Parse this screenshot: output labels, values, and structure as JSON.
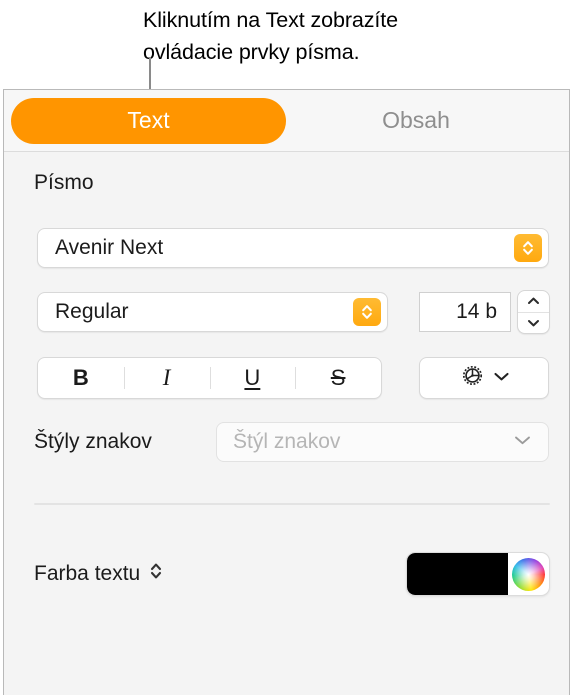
{
  "callout": {
    "line1": "Kliknutím na Text zobrazíte",
    "line2": "ovládacie prvky písma."
  },
  "tabs": [
    {
      "label": "Text",
      "active": true
    },
    {
      "label": "Obsah",
      "active": false
    }
  ],
  "font_section": {
    "heading": "Písmo",
    "family_value": "Avenir Next",
    "typeface_value": "Regular",
    "size_value": "14 b"
  },
  "format_buttons": [
    {
      "name": "bold",
      "label": "B"
    },
    {
      "name": "italic",
      "label": "I"
    },
    {
      "name": "underline",
      "label": "U"
    },
    {
      "name": "strikethrough",
      "label": "S"
    }
  ],
  "character_styles": {
    "label": "Štýly znakov",
    "placeholder": "Štýl znakov"
  },
  "text_color": {
    "label": "Farba textu",
    "swatch_color": "#000000"
  },
  "colors": {
    "accent_orange": "#FF9500",
    "stepper_orange": "#FFAE14",
    "panel_bg": "#F4F4F4",
    "inactive_tab_text": "#8E8E8E"
  }
}
